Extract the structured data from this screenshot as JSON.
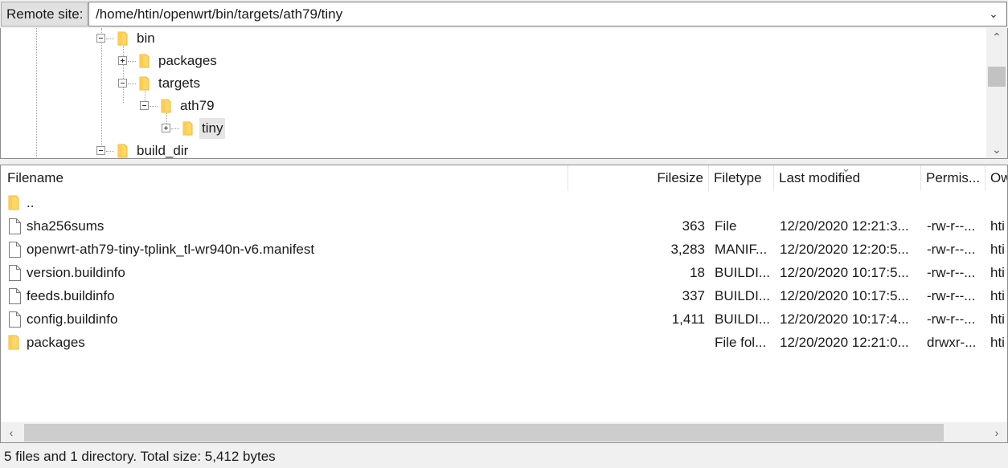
{
  "remote_site": {
    "label": "Remote site:",
    "path": "/home/htin/openwrt/bin/targets/ath79/tiny"
  },
  "tree": {
    "nodes": [
      {
        "label": "bin",
        "expander": "minus"
      },
      {
        "label": "packages",
        "expander": "plus"
      },
      {
        "label": "targets",
        "expander": "minus"
      },
      {
        "label": "ath79",
        "expander": "minus"
      },
      {
        "label": "tiny",
        "expander": "plus",
        "selected": true
      },
      {
        "label": "build_dir",
        "expander": "minus"
      }
    ]
  },
  "file_list": {
    "columns": [
      "Filename",
      "Filesize",
      "Filetype",
      "Last modified",
      "Permis...",
      "Ow"
    ],
    "sorted_column": "Last modified",
    "rows": [
      {
        "name": "..",
        "size": "",
        "type": "",
        "modified": "",
        "perms": "",
        "owner": "",
        "icon": "folder-icon"
      },
      {
        "name": "sha256sums",
        "size": "363",
        "type": "File",
        "modified": "12/20/2020 12:21:3...",
        "perms": "-rw-r--...",
        "owner": "hti",
        "icon": "file-icon"
      },
      {
        "name": "openwrt-ath79-tiny-tplink_tl-wr940n-v6.manifest",
        "size": "3,283",
        "type": "MANIF...",
        "modified": "12/20/2020 12:20:5...",
        "perms": "-rw-r--...",
        "owner": "hti",
        "icon": "file-icon"
      },
      {
        "name": "version.buildinfo",
        "size": "18",
        "type": "BUILDI...",
        "modified": "12/20/2020 10:17:5...",
        "perms": "-rw-r--...",
        "owner": "hti",
        "icon": "file-icon"
      },
      {
        "name": "feeds.buildinfo",
        "size": "337",
        "type": "BUILDI...",
        "modified": "12/20/2020 10:17:5...",
        "perms": "-rw-r--...",
        "owner": "hti",
        "icon": "file-icon"
      },
      {
        "name": "config.buildinfo",
        "size": "1,411",
        "type": "BUILDI...",
        "modified": "12/20/2020 10:17:4...",
        "perms": "-rw-r--...",
        "owner": "hti",
        "icon": "file-icon"
      },
      {
        "name": "packages",
        "size": "",
        "type": "File fol...",
        "modified": "12/20/2020 12:21:0...",
        "perms": "drwxr-...",
        "owner": "hti",
        "icon": "folder-icon"
      }
    ]
  },
  "status": {
    "text": "5 files and 1 directory. Total size: 5,412 bytes"
  },
  "colors": {
    "folder": "#ffd766",
    "folder_dark": "#e8b93c",
    "selection": "#e5e5e5"
  }
}
